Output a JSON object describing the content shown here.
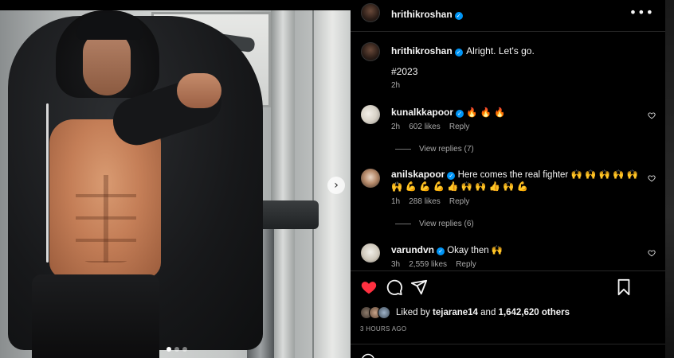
{
  "post": {
    "author": "hrithikroshan",
    "caption": "Alright. Let's go.",
    "hashtag": "#2023",
    "caption_time": "2h",
    "image_count": 3,
    "active_image": 1
  },
  "comments": [
    {
      "username": "kunalkkapoor",
      "verified": true,
      "text": "🔥 🔥 🔥",
      "time": "2h",
      "likes": "602 likes",
      "reply_label": "Reply",
      "view_replies": "View replies (7)"
    },
    {
      "username": "anilskapoor",
      "verified": true,
      "text_line1": "Here comes the real fighter 🙌 🙌 🙌 🙌 🙌 🙌",
      "text_line2": "🙌 💪 💪 💪 👍 🙌 🙌 👍 🙌 💪",
      "time": "1h",
      "likes": "288 likes",
      "reply_label": "Reply",
      "view_replies": "View replies (6)"
    },
    {
      "username": "varundvn",
      "verified": true,
      "text": "Okay then 🙌",
      "time": "3h",
      "likes": "2,559 likes",
      "reply_label": "Reply"
    }
  ],
  "engagement": {
    "liked_by_prefix": "Liked by",
    "liked_by_user": "tejarane14",
    "and_label": "and",
    "others_count": "1,642,620 others",
    "posted_ago": "3 HOURS AGO"
  },
  "icons": {
    "like": "heart-filled-icon",
    "comment": "comment-icon",
    "share": "send-icon",
    "save": "bookmark-icon",
    "more": "more-horizontal-icon",
    "next": "chevron-right-icon"
  },
  "colors": {
    "background": "#000000",
    "text_primary": "#f5f5f5",
    "text_secondary": "#a8a8a8",
    "liked_red": "#ff3040",
    "verified_blue": "#0095f6",
    "divider": "#262626"
  }
}
